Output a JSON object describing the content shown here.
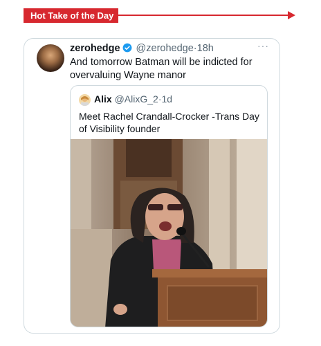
{
  "banner": {
    "label": "Hot Take of the Day"
  },
  "tweet": {
    "display_name": "zerohedge",
    "handle": "@zerohedge",
    "separator": "·",
    "time": "18h",
    "more": "···",
    "text": "And tomorrow Batman will be indicted for overvaluing Wayne manor"
  },
  "quoted_tweet": {
    "display_name": "Alix",
    "handle": "@AlixG_2",
    "separator": "·",
    "time": "1d",
    "text": "Meet Rachel Crandall-Crocker -Trans Day of Visibility founder"
  },
  "colors": {
    "banner": "#d7282f",
    "verified": "#1d9bf0",
    "border": "#cfd9de",
    "muted": "#536471"
  },
  "icons": {
    "verified": "verified-badge-icon",
    "more": "more-options-icon"
  }
}
